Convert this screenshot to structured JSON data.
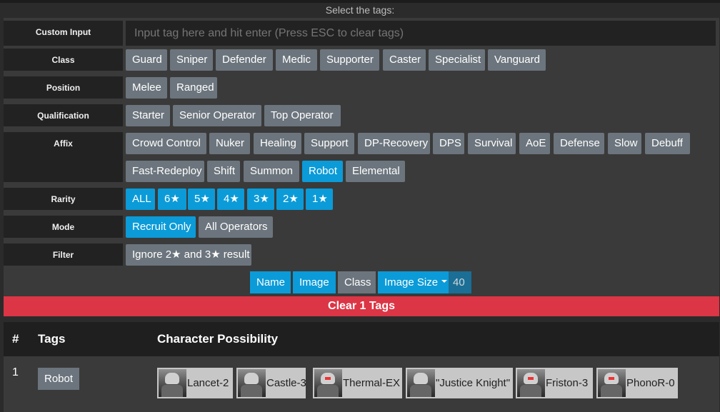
{
  "header": {
    "title": "Select the tags:"
  },
  "custom_input": {
    "label": "Custom Input",
    "placeholder": "Input tag here and hit enter (Press ESC to clear tags)"
  },
  "rows": {
    "class": {
      "label": "Class",
      "tags": [
        "Guard",
        "Sniper",
        "Defender",
        "Medic",
        "Supporter",
        "Caster",
        "Specialist",
        "Vanguard"
      ]
    },
    "position": {
      "label": "Position",
      "tags": [
        "Melee",
        "Ranged"
      ]
    },
    "qualification": {
      "label": "Qualification",
      "tags": [
        "Starter",
        "Senior Operator",
        "Top Operator"
      ]
    },
    "affix": {
      "label": "Affix",
      "tags": [
        "Crowd Control",
        "Nuker",
        "Healing",
        "Support",
        "DP-Recovery",
        "DPS",
        "Survival",
        "AoE",
        "Defense",
        "Slow",
        "Debuff",
        "Fast-Redeploy",
        "Shift",
        "Summon",
        "Robot",
        "Elemental"
      ],
      "active": "Robot"
    },
    "rarity": {
      "label": "Rarity",
      "tags": [
        "ALL",
        "6★",
        "5★",
        "4★",
        "3★",
        "2★",
        "1★"
      ]
    },
    "mode": {
      "label": "Mode",
      "tags": [
        "Recruit Only",
        "All Operators"
      ],
      "active": "Recruit Only"
    },
    "filter": {
      "label": "Filter",
      "tags": [
        "Ignore 2★ and 3★ result"
      ]
    }
  },
  "controls": {
    "name": "Name",
    "image": "Image",
    "class": "Class",
    "image_size": "Image Size",
    "image_size_value": "40"
  },
  "clear_button": "Clear 1 Tags",
  "results": {
    "headers": {
      "num": "#",
      "tags": "Tags",
      "chars": "Character Possibility"
    },
    "rows": [
      {
        "num": "1",
        "tag": "Robot",
        "characters": [
          "Lancet-2",
          "Castle-3",
          "Thermal-EX",
          "\"Justice Knight\"",
          "Friston-3",
          "PhonoR-0"
        ]
      }
    ]
  },
  "colors": {
    "active": "#0b9bd8",
    "inactive": "#6c757d",
    "danger": "#dc3545",
    "label_bg": "#222222"
  }
}
